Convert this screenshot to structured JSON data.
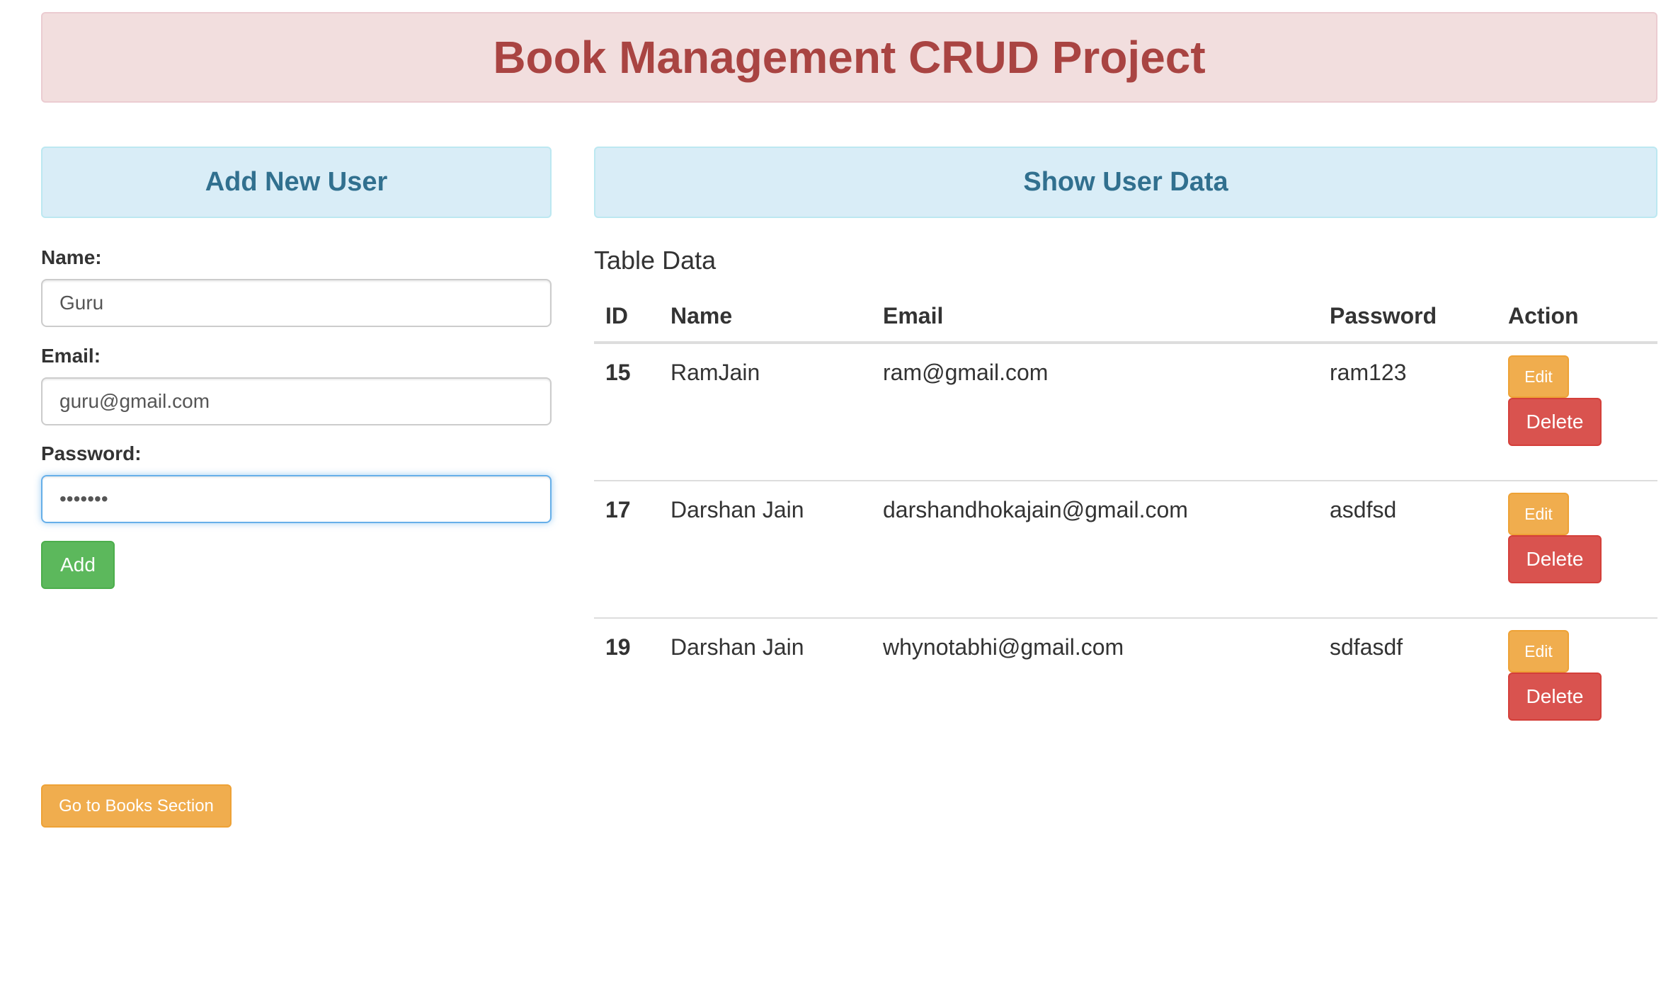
{
  "header": {
    "title": "Book Management CRUD Project"
  },
  "left_panel": {
    "title": "Add New User",
    "form": {
      "name_label": "Name:",
      "name_value": "Guru",
      "email_label": "Email:",
      "email_value": "guru@gmail.com",
      "password_label": "Password:",
      "password_value": "•••••••",
      "add_button": "Add"
    },
    "books_button": "Go to Books Section"
  },
  "right_panel": {
    "title": "Show User Data",
    "table_title": "Table Data",
    "table": {
      "columns": [
        "ID",
        "Name",
        "Email",
        "Password",
        "Action"
      ],
      "rows": [
        {
          "id": "15",
          "name": "RamJain",
          "email": "ram@gmail.com",
          "password": "ram123",
          "edit": "Edit",
          "delete": "Delete"
        },
        {
          "id": "17",
          "name": "Darshan Jain",
          "email": "darshandhokajain@gmail.com",
          "password": "asdfsd",
          "edit": "Edit",
          "delete": "Delete"
        },
        {
          "id": "19",
          "name": "Darshan Jain",
          "email": "whynotabhi@gmail.com",
          "password": "sdfasdf",
          "edit": "Edit",
          "delete": "Delete"
        }
      ]
    }
  },
  "colors": {
    "header_bg": "#f2dede",
    "header_text": "#a94442",
    "panel_bg": "#d9edf7",
    "panel_text": "#31708f",
    "success": "#5cb85c",
    "warning": "#f0ad4e",
    "danger": "#d9534f"
  }
}
